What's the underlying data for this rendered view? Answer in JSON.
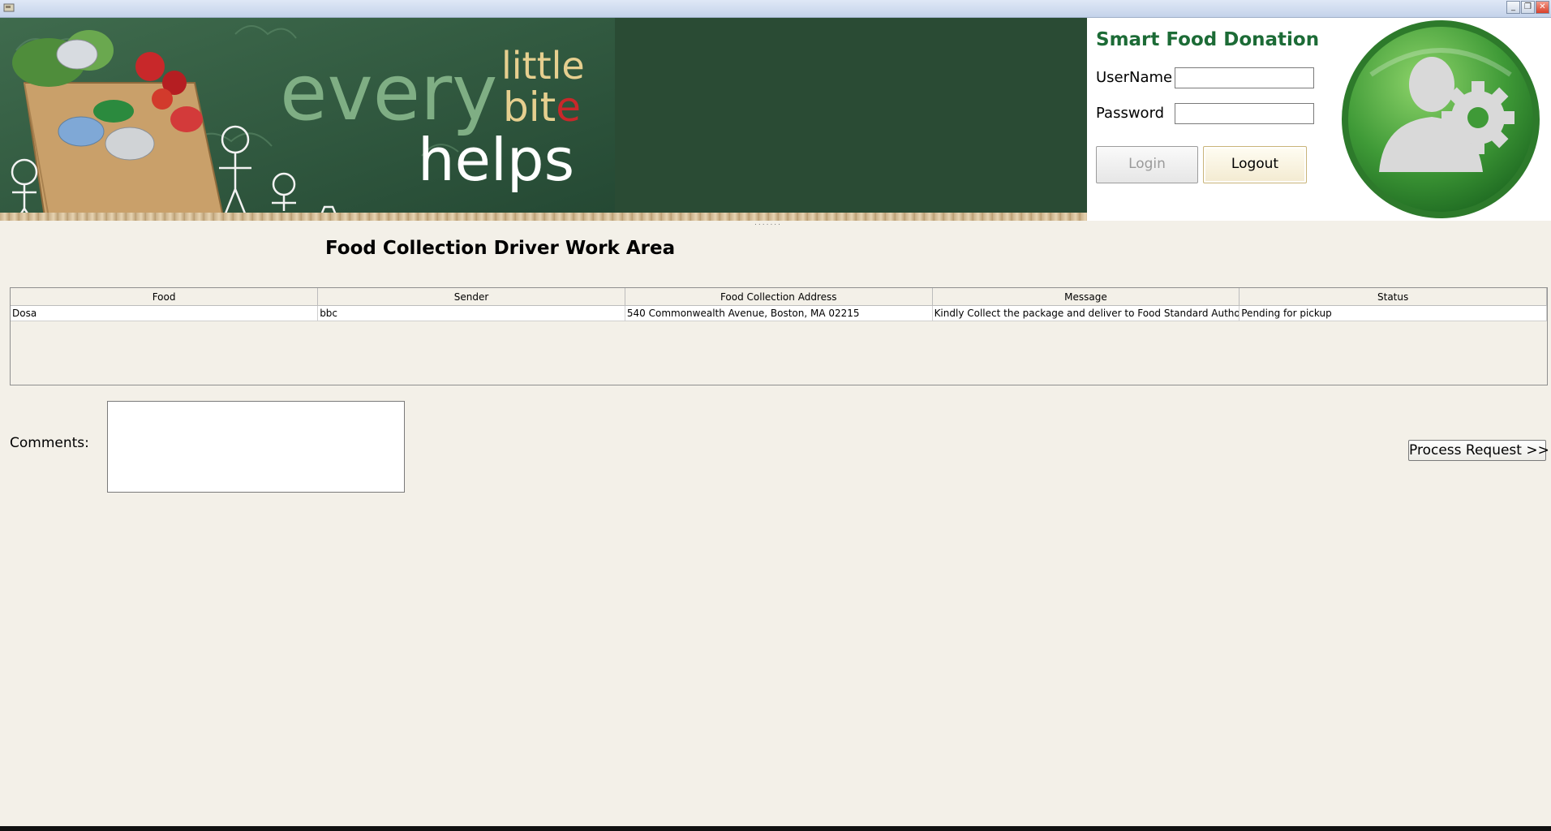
{
  "banner": {
    "word1": "every",
    "word2": "little",
    "word3": "bit",
    "word3_accent": "e",
    "word4": "helps"
  },
  "login_panel": {
    "brand": "Smart Food Donation",
    "username_label": "UserName",
    "username_value": "",
    "password_label": "Password",
    "password_value": "",
    "login_button": "Login",
    "logout_button": "Logout"
  },
  "work_area": {
    "title": "Food Collection Driver Work Area",
    "table": {
      "columns": [
        "Food",
        "Sender",
        "Food Collection Address",
        "Message",
        "Status"
      ],
      "rows": [
        [
          "Dosa",
          "bbc",
          "540 Commonwealth Avenue, Boston, MA 02215",
          "Kindly Collect the package and deliver to Food Standard Authority",
          "Pending for pickup"
        ]
      ]
    },
    "comments_label": "Comments:",
    "comments_value": "",
    "process_button": "Process Request >>"
  },
  "colors": {
    "brand_green": "#1c6b36",
    "chalkboard": "#2a4b34",
    "background": "#f3f0e8"
  },
  "icons": {
    "window_min": "minimize-icon",
    "window_max": "maximize-icon",
    "window_close": "close-icon",
    "avatar": "user-settings-icon"
  }
}
